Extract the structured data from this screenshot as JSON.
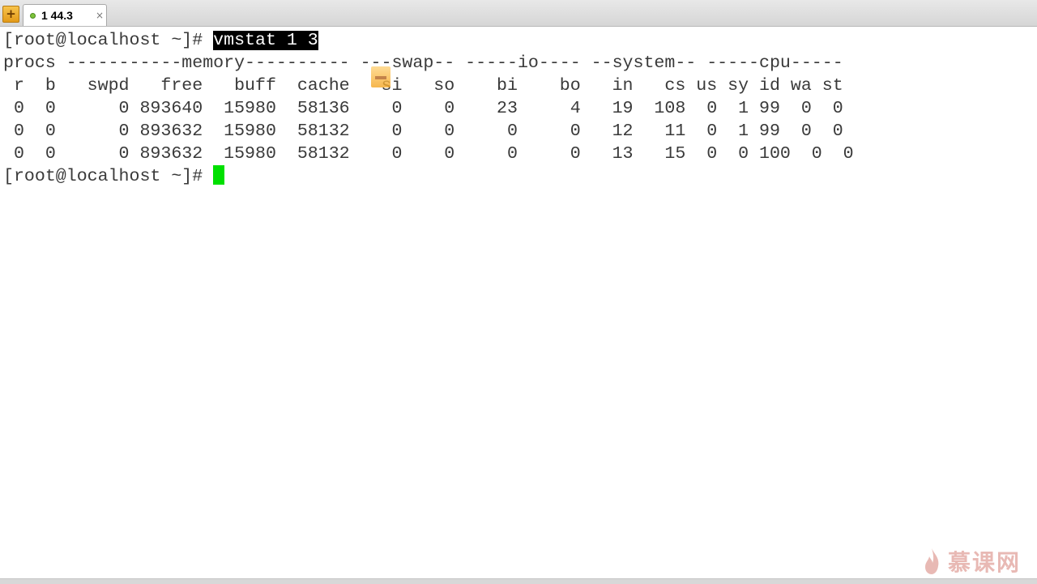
{
  "tab": {
    "title": "1 44.3",
    "close_glyph": "×",
    "status_color": "#7dc33a"
  },
  "terminal": {
    "prompt1": "[root@localhost ~]# ",
    "command": "vmstat 1 3",
    "header1": "procs -----------memory---------- ---swap-- -----io---- --system-- -----cpu-----",
    "header2": " r  b   swpd   free   buff  cache   si   so    bi    bo   in   cs us sy id wa st",
    "rows": [
      " 0  0      0 893640  15980  58136    0    0    23     4   19  108  0  1 99  0  0",
      " 0  0      0 893632  15980  58132    0    0     0     0   12   11  0  1 99  0  0",
      " 0  0      0 893632  15980  58132    0    0     0     0   13   15  0  0 100  0  0"
    ],
    "prompt2": "[root@localhost ~]# ",
    "cursor_color": "#00e000"
  },
  "watermark": {
    "text": "慕课网"
  },
  "icons": {
    "add_tab": "plus-icon",
    "status": "status-dot-icon",
    "close": "close-icon",
    "overlay": "floating-toolbar-icon",
    "watermark": "flame-logo-icon"
  }
}
